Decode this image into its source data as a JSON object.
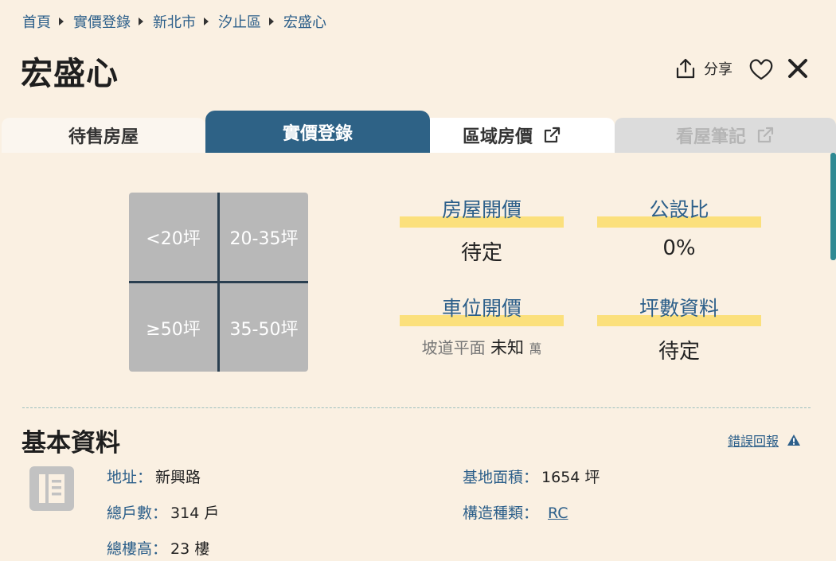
{
  "breadcrumb": [
    "首頁",
    "實價登錄",
    "新北市",
    "汐止區",
    "宏盛心"
  ],
  "title": "宏盛心",
  "actions": {
    "share_label": "分享"
  },
  "tabs": [
    {
      "label": "待售房屋",
      "state": "inactive"
    },
    {
      "label": "實價登錄",
      "state": "active"
    },
    {
      "label": "區域房價",
      "state": "inactive",
      "icon": "external-link-icon"
    },
    {
      "label": "看屋筆記",
      "state": "disabled",
      "icon": "external-link-icon"
    }
  ],
  "size_filters": [
    "<20坪",
    "20-35坪",
    "≥50坪",
    "35-50坪"
  ],
  "stats": {
    "opening_price": {
      "label": "房屋開價",
      "value": "待定"
    },
    "public_ratio": {
      "label": "公設比",
      "value": "0%"
    },
    "parking_price": {
      "label": "車位開價",
      "type": "坡道平面",
      "value": "未知",
      "unit": "萬"
    },
    "ping_data": {
      "label": "坪數資料",
      "value": "待定"
    }
  },
  "basic_info": {
    "title": "基本資料",
    "report_label": "錯誤回報",
    "address_label": "地址：",
    "address": "新興路",
    "households_label": "總戶數：",
    "households": "314 戶",
    "floors_label": "總樓高：",
    "floors": "23 樓",
    "land_area_label": "基地面積：",
    "land_area": "1654 坪",
    "structure_label": "構造種類：",
    "structure": "RC"
  },
  "colors": {
    "accent": "#2e6286",
    "background": "#faf0e2",
    "highlight": "#fbe07c",
    "link": "#2c5f8a"
  }
}
